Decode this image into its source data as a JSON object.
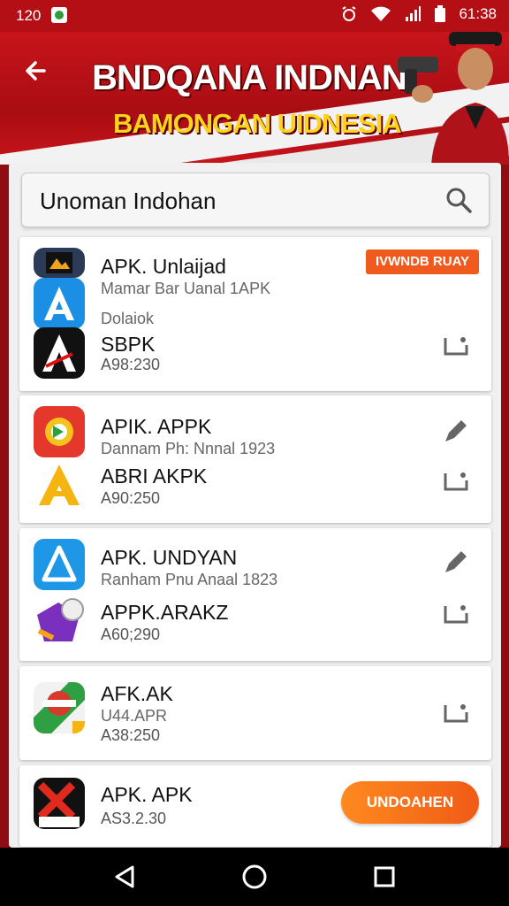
{
  "status_bar": {
    "time_left": "120",
    "time_right": "61:38"
  },
  "banner": {
    "title": "BNDQANA INDNAN",
    "subtitle": "BAMONGAN UIDNESIA"
  },
  "search": {
    "value": "Unoman Indohan"
  },
  "cards": [
    {
      "badge": "IVWNDB RUAY",
      "title": "APK. Unlaijad",
      "subtitle": "Mamar Bar Uanal 1APK",
      "extra": "Dolaiok",
      "title2": "SBPK",
      "size": "A98:230"
    },
    {
      "title": "APIK. APPK",
      "subtitle": "Dannam Ph: Nnnal 1923",
      "title2": "ABRI AKPK",
      "size": "A90:250"
    },
    {
      "title": "APK. UNDYAN",
      "subtitle": "Ranham Pnu Anaal 1823",
      "title2": "APPK.ARAKZ",
      "size": "A60;290"
    },
    {
      "title": "AFK.AK",
      "subtitle": "U44.APR",
      "size": "A38:250"
    },
    {
      "title": "APK. APK",
      "size": "AS3.2.30",
      "button": "UNDOAHEN"
    }
  ],
  "colors": {
    "brand_red": "#c8141b",
    "accent_orange": "#f15a1e",
    "highlight_yellow": "#ffd21c"
  }
}
